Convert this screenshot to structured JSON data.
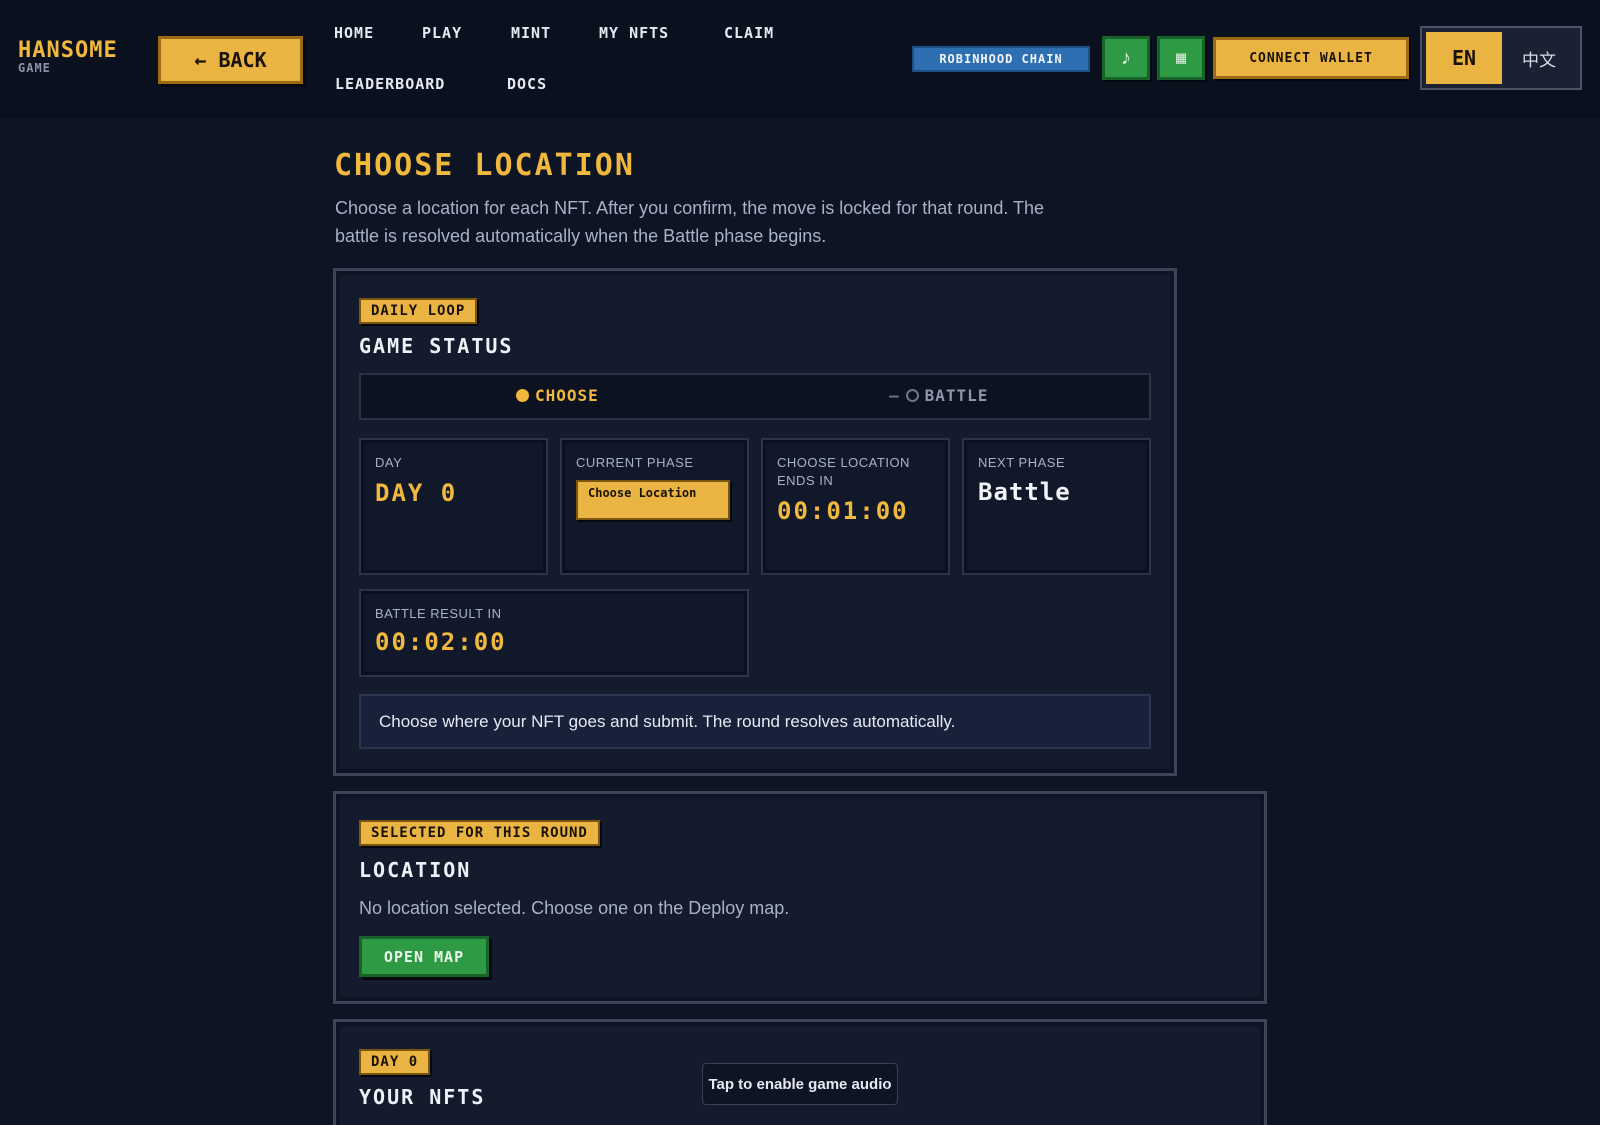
{
  "header": {
    "logo_main": "HANSOME",
    "logo_sub": "GAME",
    "back_label": "← BACK",
    "nav": [
      "HOME",
      "PLAY",
      "MINT",
      "MY NFTS",
      "CLAIM",
      "LEADERBOARD",
      "DOCS"
    ],
    "chain_badge": "ROBINHOOD CHAIN",
    "music_icon": "♪",
    "grid_icon": "▦",
    "connect_label": "CONNECT WALLET",
    "lang_en": "EN",
    "lang_zh": "中文"
  },
  "page": {
    "title": "CHOOSE LOCATION",
    "description": "Choose a location for each NFT. After you confirm, the move is locked for that round. The battle is resolved automatically when the Battle phase begins."
  },
  "game_status": {
    "tag": "DAILY LOOP",
    "title": "GAME STATUS",
    "phases": {
      "choose": "CHOOSE",
      "separator": "—",
      "battle": "BATTLE"
    },
    "day": {
      "label": "DAY",
      "value": "DAY 0"
    },
    "current_phase": {
      "label": "CURRENT PHASE",
      "value": "Choose Location"
    },
    "choose_ends": {
      "label": "CHOOSE LOCATION ENDS IN",
      "value": "00:01:00"
    },
    "next_phase": {
      "label": "NEXT PHASE",
      "value": "Battle"
    },
    "battle_result": {
      "label": "BATTLE RESULT IN",
      "value": "00:02:00"
    },
    "info": "Choose where your NFT goes and submit. The round resolves automatically."
  },
  "location": {
    "tag": "SELECTED FOR THIS ROUND",
    "title": "LOCATION",
    "text": "No location selected. Choose one on the Deploy map.",
    "button": "OPEN MAP"
  },
  "nfts": {
    "tag": "DAY 0",
    "title": "YOUR NFTS"
  },
  "toast": "Tap to enable game audio",
  "colors": {
    "accent": "#eab443",
    "green": "#2e9a43",
    "chain_blue": "#2d6fb0",
    "background": "#0d1424"
  }
}
